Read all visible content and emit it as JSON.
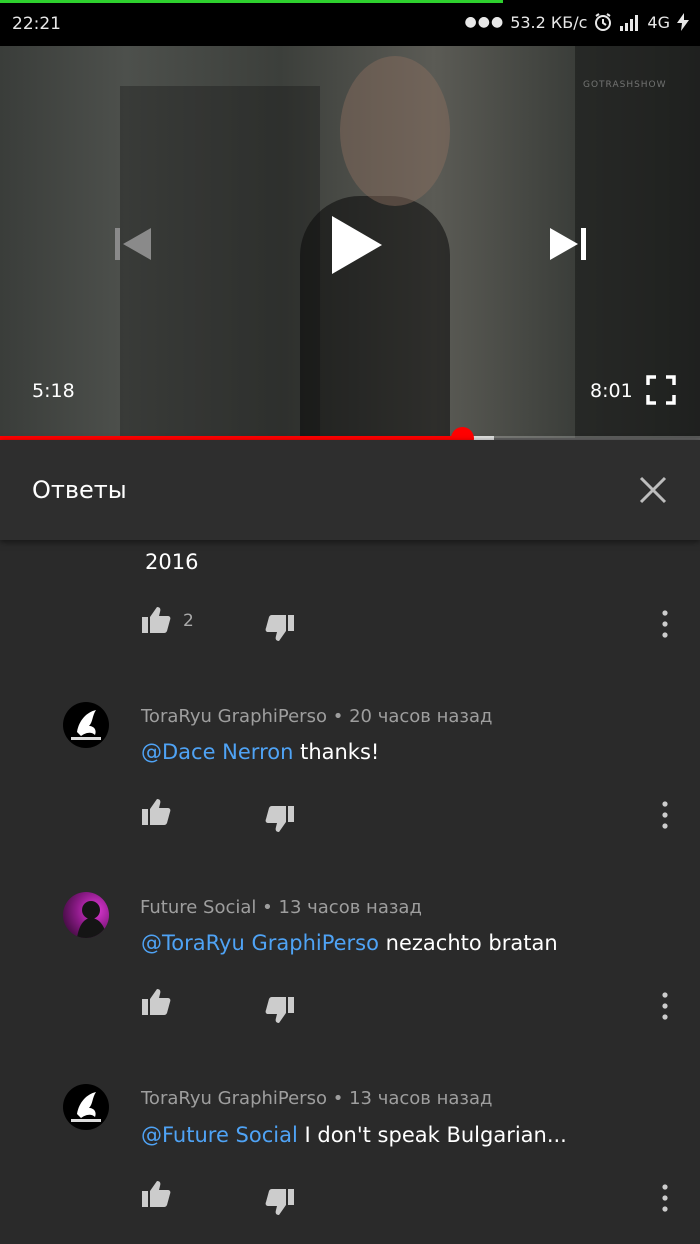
{
  "status_bar": {
    "time": "22:21",
    "network_speed": "53.2 КБ/с",
    "network_type": "4G"
  },
  "video": {
    "watermark": "GOTRASHSHOW",
    "current_time": "5:18",
    "duration": "8:01",
    "progress_fraction": 0.66,
    "buffered_fraction": 0.705
  },
  "panel": {
    "title": "Ответы"
  },
  "comments": [
    {
      "text": "2016",
      "likes": "2"
    },
    {
      "author": "ToraRyu GraphiPerso",
      "separator": "•",
      "time": "20 часов назад",
      "mention": "@Dace Nerron",
      "text": " thanks!"
    },
    {
      "author": "Future Social",
      "separator": "•",
      "time": "13 часов назад",
      "mention": "@ToraRyu GraphiPerso",
      "text": " nezachto bratan"
    },
    {
      "author": "ToraRyu GraphiPerso",
      "separator": "•",
      "time": "13 часов назад",
      "mention": "@Future Social",
      "text": " I don't speak Bulgarian..."
    }
  ],
  "colors": {
    "accent": "#ff0000",
    "mention": "#4fa3f5",
    "background": "#2a2a2a",
    "loading": "#2ed12e"
  }
}
